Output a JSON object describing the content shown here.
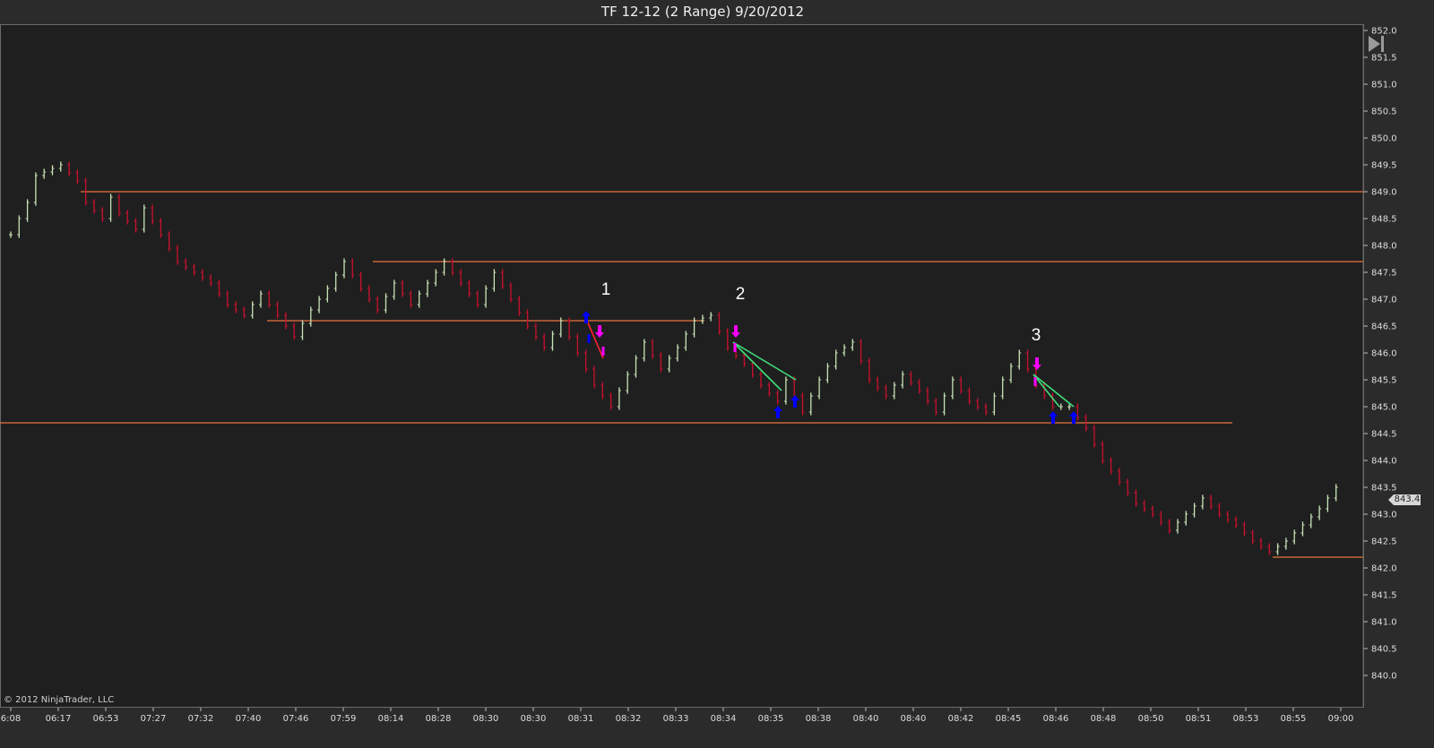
{
  "title": "TF 12-12 (2 Range)  9/20/2012",
  "copyright": "© 2012 NinjaTrader, LLC",
  "last_price_label": "843.4",
  "icons": {
    "scroll_end": "skip-to-end-icon"
  },
  "colors": {
    "background": "#1f1f1f",
    "up_bar": "#c9e4b8",
    "down_bar": "#c8102e",
    "support_line": "#c8653a",
    "buy_marker": "#0000ff",
    "sell_marker": "#ff00ff",
    "trend_line": "#3ee07a",
    "trend_line_red": "#ff2030"
  },
  "chart_data": {
    "type": "line",
    "title": "TF 12-12 (2 Range)  9/20/2012",
    "xlabel": "",
    "ylabel": "",
    "ylim": [
      839.65,
      852.1
    ],
    "y_ticks": [
      "840.0",
      "840.5",
      "841.0",
      "841.5",
      "842.0",
      "842.5",
      "843.0",
      "843.5",
      "844.0",
      "844.5",
      "845.0",
      "845.5",
      "846.0",
      "846.5",
      "847.0",
      "847.5",
      "848.0",
      "848.5",
      "849.0",
      "849.5",
      "850.0",
      "850.5",
      "851.0",
      "851.5",
      "852.0"
    ],
    "x_ticks": [
      "6:08",
      "06:17",
      "06:53",
      "07:27",
      "07:32",
      "07:40",
      "07:46",
      "07:59",
      "08:14",
      "08:28",
      "08:30",
      "08:30",
      "08:31",
      "08:32",
      "08:33",
      "08:34",
      "08:35",
      "08:38",
      "08:40",
      "08:40",
      "08:42",
      "08:45",
      "08:46",
      "08:48",
      "08:50",
      "08:51",
      "08:53",
      "08:55",
      "09:00"
    ],
    "price_series": [
      {
        "x": 0,
        "y": 848.2
      },
      {
        "x": 2,
        "y": 848.8
      },
      {
        "x": 3,
        "y": 849.3
      },
      {
        "x": 6,
        "y": 849.5
      },
      {
        "x": 8,
        "y": 849.2
      },
      {
        "x": 9,
        "y": 848.8
      },
      {
        "x": 11,
        "y": 848.5
      },
      {
        "x": 12,
        "y": 848.9
      },
      {
        "x": 13,
        "y": 848.6
      },
      {
        "x": 15,
        "y": 848.3
      },
      {
        "x": 16,
        "y": 848.7
      },
      {
        "x": 18,
        "y": 848.2
      },
      {
        "x": 20,
        "y": 847.7
      },
      {
        "x": 22,
        "y": 847.5
      },
      {
        "x": 24,
        "y": 847.3
      },
      {
        "x": 26,
        "y": 846.9
      },
      {
        "x": 28,
        "y": 846.7
      },
      {
        "x": 30,
        "y": 847.1
      },
      {
        "x": 32,
        "y": 846.7
      },
      {
        "x": 34,
        "y": 846.3
      },
      {
        "x": 36,
        "y": 846.8
      },
      {
        "x": 38,
        "y": 847.2
      },
      {
        "x": 40,
        "y": 847.7
      },
      {
        "x": 42,
        "y": 847.2
      },
      {
        "x": 44,
        "y": 846.8
      },
      {
        "x": 46,
        "y": 847.3
      },
      {
        "x": 48,
        "y": 846.9
      },
      {
        "x": 50,
        "y": 847.3
      },
      {
        "x": 52,
        "y": 847.7
      },
      {
        "x": 54,
        "y": 847.3
      },
      {
        "x": 56,
        "y": 846.9
      },
      {
        "x": 58,
        "y": 847.5
      },
      {
        "x": 60,
        "y": 847.0
      },
      {
        "x": 62,
        "y": 846.5
      },
      {
        "x": 64,
        "y": 846.1
      },
      {
        "x": 66,
        "y": 846.6
      },
      {
        "x": 68,
        "y": 846.0
      },
      {
        "x": 70,
        "y": 845.4
      },
      {
        "x": 72,
        "y": 845.0
      },
      {
        "x": 74,
        "y": 845.6
      },
      {
        "x": 76,
        "y": 846.2
      },
      {
        "x": 78,
        "y": 845.7
      },
      {
        "x": 80,
        "y": 846.1
      },
      {
        "x": 82,
        "y": 846.6
      },
      {
        "x": 84,
        "y": 846.7
      },
      {
        "x": 86,
        "y": 846.1
      },
      {
        "x": 88,
        "y": 845.8
      },
      {
        "x": 90,
        "y": 845.4
      },
      {
        "x": 92,
        "y": 845.1
      },
      {
        "x": 93,
        "y": 845.5
      },
      {
        "x": 95,
        "y": 844.9
      },
      {
        "x": 97,
        "y": 845.5
      },
      {
        "x": 99,
        "y": 846.0
      },
      {
        "x": 101,
        "y": 846.2
      },
      {
        "x": 103,
        "y": 845.5
      },
      {
        "x": 105,
        "y": 845.2
      },
      {
        "x": 107,
        "y": 845.6
      },
      {
        "x": 109,
        "y": 845.3
      },
      {
        "x": 111,
        "y": 844.9
      },
      {
        "x": 113,
        "y": 845.5
      },
      {
        "x": 115,
        "y": 845.1
      },
      {
        "x": 117,
        "y": 844.9
      },
      {
        "x": 119,
        "y": 845.5
      },
      {
        "x": 121,
        "y": 846.0
      },
      {
        "x": 123,
        "y": 845.4
      },
      {
        "x": 125,
        "y": 845.0
      },
      {
        "x": 127,
        "y": 845.0
      },
      {
        "x": 129,
        "y": 844.6
      },
      {
        "x": 131,
        "y": 844.0
      },
      {
        "x": 133,
        "y": 843.6
      },
      {
        "x": 135,
        "y": 843.2
      },
      {
        "x": 137,
        "y": 843.0
      },
      {
        "x": 139,
        "y": 842.7
      },
      {
        "x": 141,
        "y": 843.0
      },
      {
        "x": 143,
        "y": 843.3
      },
      {
        "x": 145,
        "y": 843.0
      },
      {
        "x": 147,
        "y": 842.8
      },
      {
        "x": 149,
        "y": 842.5
      },
      {
        "x": 151,
        "y": 842.3
      },
      {
        "x": 153,
        "y": 842.5
      },
      {
        "x": 155,
        "y": 842.8
      },
      {
        "x": 157,
        "y": 843.1
      },
      {
        "x": 159,
        "y": 843.5
      }
    ],
    "horizontal_levels": [
      849.0,
      847.7,
      846.6,
      844.7,
      842.2
    ],
    "annotations": [
      "1",
      "2",
      "3"
    ],
    "last_price": 843.4,
    "grid": false,
    "legend": "none"
  }
}
